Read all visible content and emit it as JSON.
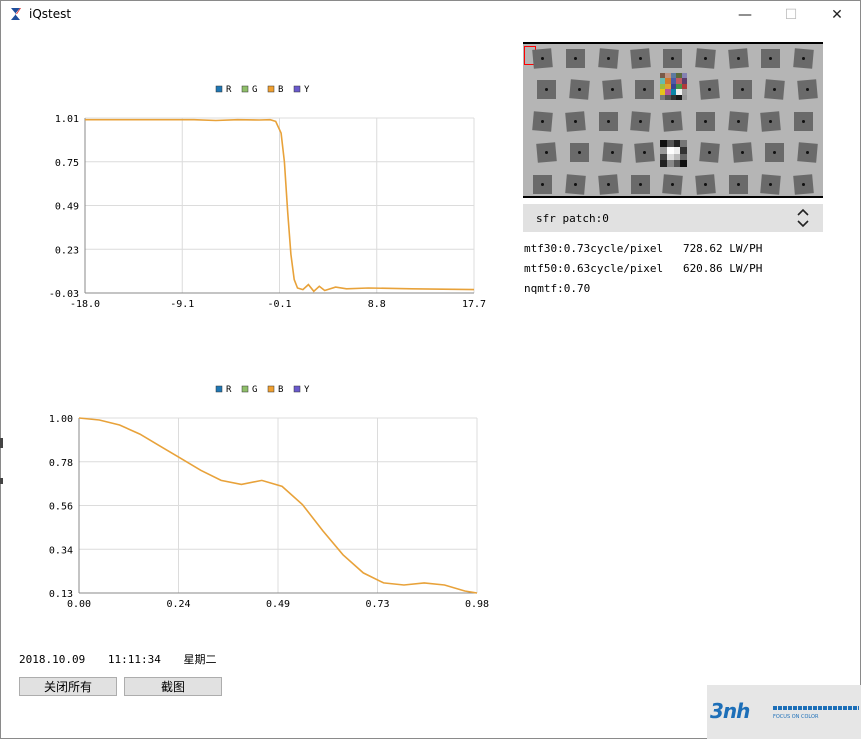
{
  "window": {
    "title": "iQstest",
    "minimize_glyph": "—",
    "maximize_glyph": "☐",
    "close_glyph": "✕"
  },
  "legend": [
    {
      "label": "R",
      "color": "#1f77b4"
    },
    {
      "label": "G",
      "color": "#8fbf6a"
    },
    {
      "label": "B",
      "color": "#f0a030"
    },
    {
      "label": "Y",
      "color": "#6a5acd"
    }
  ],
  "chart_data": [
    {
      "type": "line",
      "x_ticks": [
        "-18.0",
        "-9.1",
        "-0.1",
        "8.8",
        "17.7"
      ],
      "y_ticks": [
        "1.01",
        "0.75",
        "0.49",
        "0.23",
        "-0.03"
      ],
      "xlim": [
        -18.0,
        17.7
      ],
      "ylim": [
        -0.03,
        1.01
      ],
      "grid": true,
      "legend_position": "top",
      "series": [
        {
          "color": "#e8a23a",
          "x": [
            -18.0,
            -12,
            -8,
            -6,
            -4,
            -2,
            -1,
            -0.5,
            0.0,
            0.3,
            0.6,
            0.9,
            1.2,
            1.5,
            2.0,
            2.5,
            3.0,
            3.5,
            4.0,
            5.0,
            6.0,
            8.0,
            12.0,
            17.7
          ],
          "y": [
            1.0,
            1.0,
            1.0,
            0.995,
            1.0,
            0.998,
            1.0,
            0.99,
            0.92,
            0.75,
            0.45,
            0.2,
            0.05,
            0.0,
            -0.01,
            0.02,
            -0.02,
            0.01,
            -0.015,
            0.005,
            -0.005,
            0.0,
            -0.005,
            -0.01
          ]
        }
      ]
    },
    {
      "type": "line",
      "x_ticks": [
        "0.00",
        "0.24",
        "0.49",
        "0.73",
        "0.98"
      ],
      "y_ticks": [
        "1.00",
        "0.78",
        "0.56",
        "0.34",
        "0.13"
      ],
      "xlim": [
        0.0,
        0.98
      ],
      "ylim": [
        0.13,
        1.0
      ],
      "grid": true,
      "legend_position": "top",
      "series": [
        {
          "color": "#e8a23a",
          "x": [
            0.0,
            0.05,
            0.1,
            0.15,
            0.2,
            0.25,
            0.3,
            0.35,
            0.4,
            0.45,
            0.5,
            0.55,
            0.6,
            0.65,
            0.7,
            0.75,
            0.8,
            0.85,
            0.9,
            0.95,
            0.98
          ],
          "y": [
            1.0,
            0.99,
            0.965,
            0.92,
            0.86,
            0.8,
            0.74,
            0.69,
            0.67,
            0.69,
            0.66,
            0.57,
            0.44,
            0.32,
            0.23,
            0.18,
            0.17,
            0.18,
            0.17,
            0.14,
            0.13
          ]
        }
      ]
    }
  ],
  "sfr": {
    "patch_label": "sfr patch:0",
    "mtf30": "mtf30:0.73cycle/pixel   728.62 LW/PH",
    "mtf50": "mtf50:0.63cycle/pixel   620.86 LW/PH",
    "nqmtf": "nqmtf:0.70"
  },
  "footer": {
    "date": "2018.10.09",
    "time": "11:11:34",
    "weekday": "星期二",
    "close_all_label": "关闭所有",
    "screenshot_label": "截图"
  },
  "watermark": {
    "logo": "3nh",
    "tagline": "FOCUS ON COLOR"
  }
}
